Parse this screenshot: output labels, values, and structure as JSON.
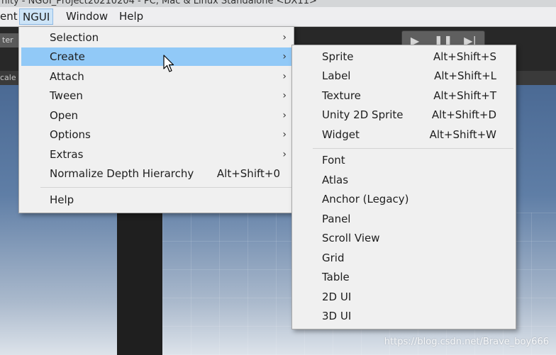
{
  "window": {
    "title": "nity - NGUI_Project20210204 - PC, Mac & Linux Standalone <DX11>"
  },
  "menubar": {
    "items": [
      {
        "label": "ent"
      },
      {
        "label": "NGUI"
      },
      {
        "label": "Window"
      },
      {
        "label": "Help"
      }
    ]
  },
  "toolbar": {
    "left_label": "ter",
    "play_icon": "play-icon",
    "pause_icon": "pause-icon",
    "step_icon": "step-icon"
  },
  "scene": {
    "scale_label": "cale"
  },
  "ngui_menu": {
    "items": [
      {
        "label": "Selection",
        "submenu": true
      },
      {
        "label": "Create",
        "submenu": true,
        "highlighted": true
      },
      {
        "label": "Attach",
        "submenu": true
      },
      {
        "label": "Tween",
        "submenu": true
      },
      {
        "label": "Open",
        "submenu": true
      },
      {
        "label": "Options",
        "submenu": true
      },
      {
        "label": "Extras",
        "submenu": true
      },
      {
        "label": "Normalize Depth Hierarchy",
        "shortcut": "Alt+Shift+0"
      },
      {
        "label": "Help"
      }
    ],
    "arrow": "›"
  },
  "create_menu": {
    "items": [
      {
        "label": "Sprite",
        "shortcut": "Alt+Shift+S"
      },
      {
        "label": "Label",
        "shortcut": "Alt+Shift+L"
      },
      {
        "label": "Texture",
        "shortcut": "Alt+Shift+T"
      },
      {
        "label": "Unity 2D Sprite",
        "shortcut": "Alt+Shift+D"
      },
      {
        "label": "Widget",
        "shortcut": "Alt+Shift+W"
      },
      {
        "label": "Font"
      },
      {
        "label": "Atlas"
      },
      {
        "label": "Anchor (Legacy)"
      },
      {
        "label": "Panel"
      },
      {
        "label": "Scroll View"
      },
      {
        "label": "Grid"
      },
      {
        "label": "Table"
      },
      {
        "label": "2D UI"
      },
      {
        "label": "3D UI"
      }
    ]
  },
  "watermark": "https://blog.csdn.net/Brave_boy666",
  "colors": {
    "highlight": "#91c9f7",
    "menu_bg": "#f0f0f0",
    "menubar_active": "#cde4f7"
  }
}
